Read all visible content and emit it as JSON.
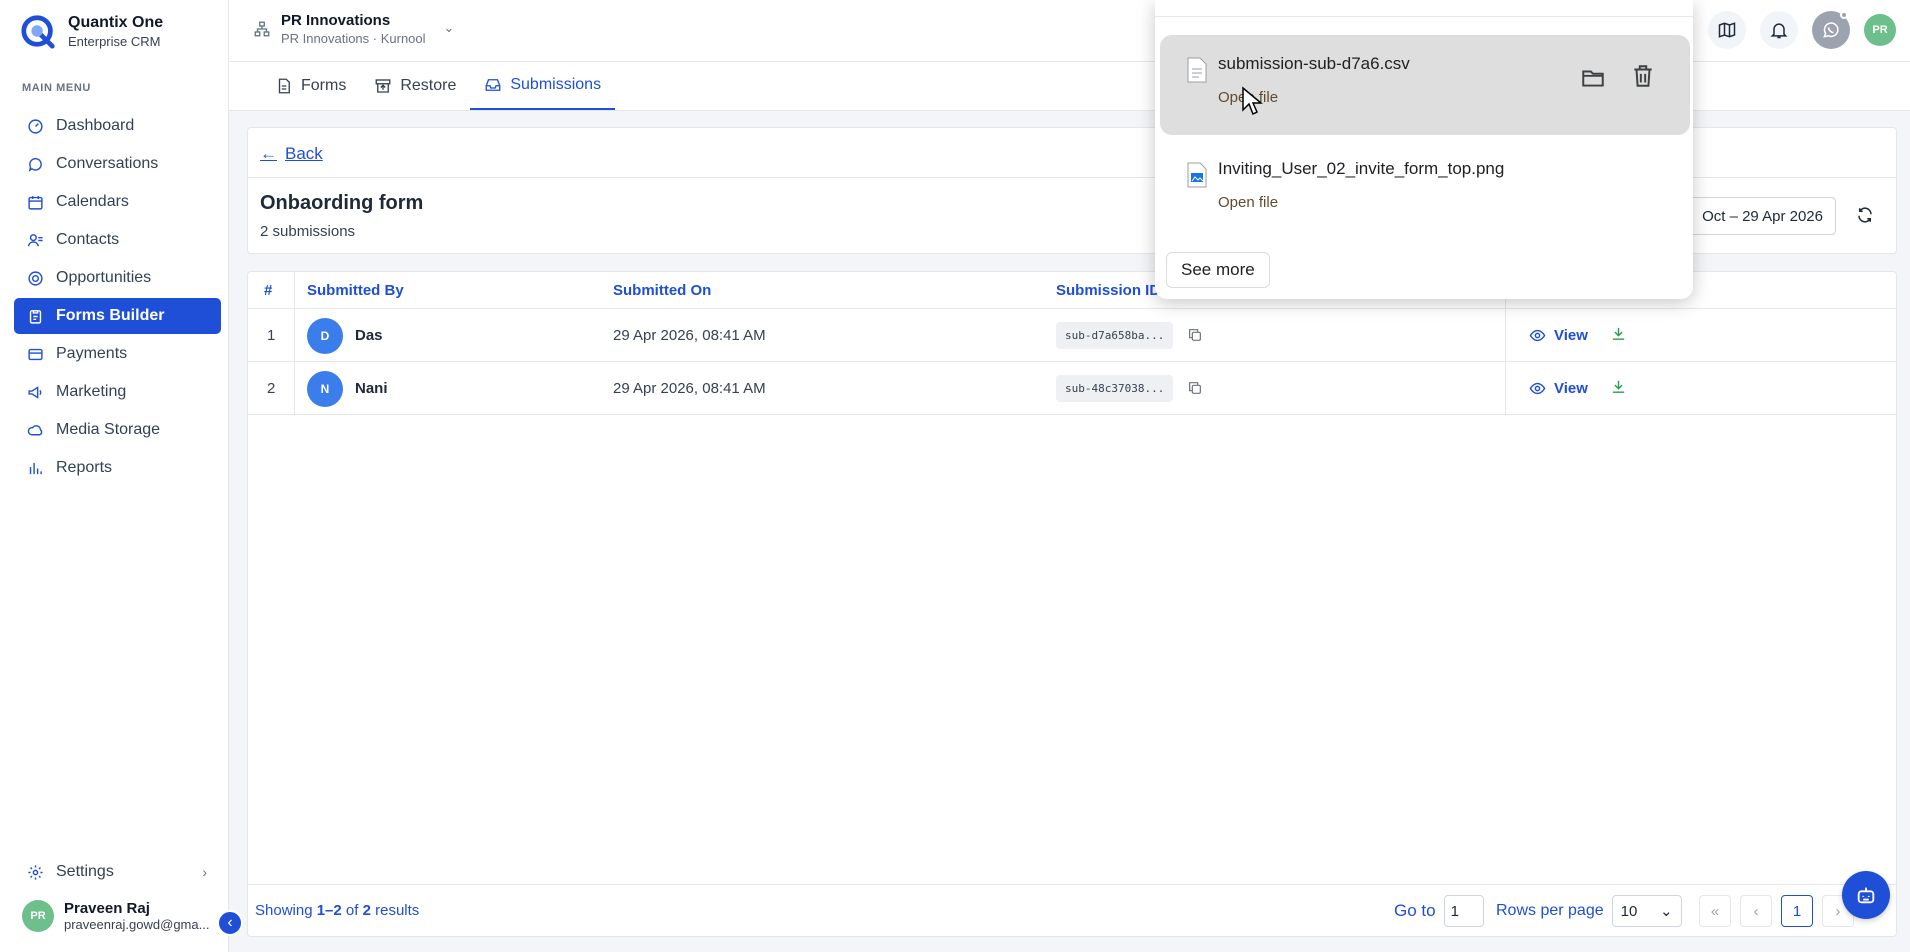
{
  "brand": {
    "name": "Quantix One",
    "subtitle": "Enterprise CRM"
  },
  "sidebar": {
    "caption": "MAIN MENU",
    "items": [
      {
        "label": "Dashboard",
        "icon": "gauge-icon"
      },
      {
        "label": "Conversations",
        "icon": "chat-icon"
      },
      {
        "label": "Calendars",
        "icon": "calendar-icon"
      },
      {
        "label": "Contacts",
        "icon": "contacts-icon"
      },
      {
        "label": "Opportunities",
        "icon": "target-icon"
      },
      {
        "label": "Forms Builder",
        "icon": "clipboard-icon",
        "active": true
      },
      {
        "label": "Payments",
        "icon": "card-icon"
      },
      {
        "label": "Marketing",
        "icon": "megaphone-icon"
      },
      {
        "label": "Media Storage",
        "icon": "cloud-icon"
      },
      {
        "label": "Reports",
        "icon": "bar-chart-icon"
      }
    ],
    "settings_label": "Settings",
    "user": {
      "initials": "PR",
      "name": "Praveen Raj",
      "email": "praveenraj.gowd@gma..."
    }
  },
  "topbar": {
    "org_name": "PR Innovations",
    "org_sub": "PR Innovations · Kurnool",
    "avatar_initials": "PR"
  },
  "tabs": [
    {
      "label": "Forms"
    },
    {
      "label": "Restore"
    },
    {
      "label": "Submissions",
      "active": true
    }
  ],
  "header": {
    "back_label": "Back",
    "title": "Onbaording form",
    "count": "2 submissions",
    "date_range": "Oct – 29 Apr 2026"
  },
  "table": {
    "columns": [
      "#",
      "Submitted By",
      "Submitted On",
      "Submission ID"
    ],
    "rows": [
      {
        "index": "1",
        "initial": "D",
        "name": "Das",
        "date": "29 Apr 2026, 08:41 AM",
        "id": "sub-d7a658ba...",
        "action": "View"
      },
      {
        "index": "2",
        "initial": "N",
        "name": "Nani",
        "date": "29 Apr 2026, 08:41 AM",
        "id": "sub-48c37038...",
        "action": "View"
      }
    ],
    "footer": {
      "showing_prefix": "Showing ",
      "showing_range": "1–2",
      "showing_of": " of ",
      "showing_total": "2",
      "showing_suffix": " results",
      "goto_label": "Go to",
      "goto_value": "1",
      "rpp_label": "Rows per page",
      "rpp_value": "10",
      "current_page": "1"
    }
  },
  "downloads": {
    "items": [
      {
        "filename": "submission-sub-d7a6.csv",
        "action": "Open file"
      },
      {
        "filename": "Inviting_User_02_invite_form_top.png",
        "action": "Open file"
      }
    ],
    "see_more": "See more"
  },
  "colors": {
    "accent": "#1f4fd6",
    "download": "#22a04a",
    "avatar_user": "#6dbf8b",
    "avatar_row": "#3b7dea"
  }
}
